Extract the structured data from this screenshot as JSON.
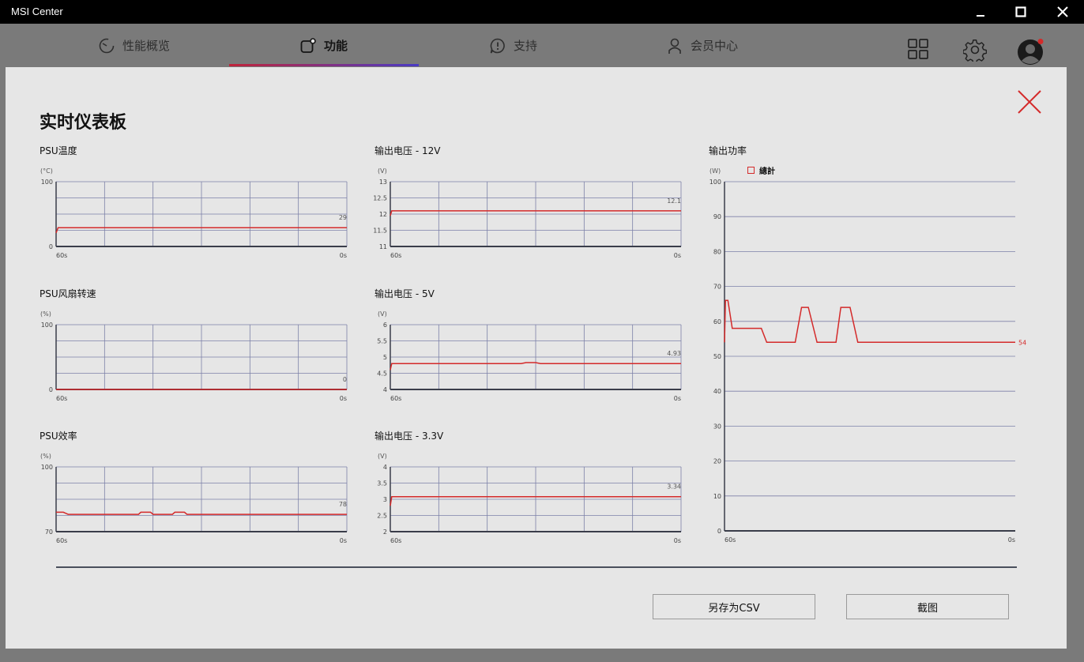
{
  "window": {
    "title": "MSI Center"
  },
  "nav": {
    "tabs": [
      {
        "label": "性能概览"
      },
      {
        "label": "功能"
      },
      {
        "label": "支持"
      },
      {
        "label": "会员中心"
      }
    ],
    "active_tab": "功能"
  },
  "dashboard": {
    "title": "实时仪表板",
    "buttons": {
      "save_csv": "另存为CSV",
      "screenshot": "截图"
    },
    "accent_color": "#d42a2a"
  },
  "chart_data": [
    {
      "id": "psu-temp",
      "type": "line",
      "title": "PSU温度",
      "unit": "(°C)",
      "ylim": [
        0,
        100
      ],
      "yticks": [
        0,
        100
      ],
      "xlabels": [
        "60s",
        "0s"
      ],
      "current_label": "29",
      "current": 29,
      "series": [
        {
          "x": [
            60,
            59.6,
            0
          ],
          "y": [
            21,
            29,
            29
          ]
        }
      ]
    },
    {
      "id": "psu-fan",
      "type": "line",
      "title": "PSU风扇转速",
      "unit": "(%)",
      "ylim": [
        0,
        100
      ],
      "yticks": [
        0,
        100
      ],
      "xlabels": [
        "60s",
        "0s"
      ],
      "current_label": "0",
      "current": 0,
      "series": [
        {
          "x": [
            60,
            0
          ],
          "y": [
            0,
            0
          ]
        }
      ]
    },
    {
      "id": "psu-eff",
      "type": "line",
      "title": "PSU效率",
      "unit": "(%)",
      "ylim": [
        70,
        100
      ],
      "yticks": [
        70,
        100
      ],
      "xlabels": [
        "60s",
        "0s"
      ],
      "current_label": "78",
      "current": 78,
      "series": [
        {
          "x": [
            60,
            58.5,
            58,
            57.5,
            43,
            42.5,
            40.5,
            40,
            36,
            35.5,
            33.5,
            33,
            0
          ],
          "y": [
            79,
            79,
            78.5,
            78,
            78,
            79,
            79,
            78,
            78,
            79,
            79,
            78,
            78
          ]
        }
      ]
    },
    {
      "id": "v12",
      "type": "line",
      "title": "输出电压 - 12V",
      "unit": "(V)",
      "ylim": [
        11,
        13
      ],
      "yticks": [
        11,
        11.5,
        12,
        12.5,
        13
      ],
      "xlabels": [
        "60s",
        "0s"
      ],
      "current_label": "12.1",
      "current": 12.1,
      "series": [
        {
          "x": [
            60,
            59.7,
            0
          ],
          "y": [
            11.95,
            12.1,
            12.1
          ]
        }
      ]
    },
    {
      "id": "v5",
      "type": "line",
      "title": "输出电压  - 5V",
      "unit": "(V)",
      "ylim": [
        4,
        6
      ],
      "yticks": [
        4,
        4.5,
        5,
        5.5,
        6
      ],
      "xlabels": [
        "60s",
        "0s"
      ],
      "current_label": "4.93",
      "current": 4.93,
      "series": [
        {
          "x": [
            60,
            59.7,
            33,
            32,
            30,
            29,
            0
          ],
          "y": [
            4.6,
            4.8,
            4.8,
            4.83,
            4.83,
            4.8,
            4.8
          ]
        }
      ]
    },
    {
      "id": "v33",
      "type": "line",
      "title": "输出电压  - 3.3V",
      "unit": "(V)",
      "ylim": [
        2,
        4
      ],
      "yticks": [
        2,
        2.5,
        3,
        3.5,
        4
      ],
      "xlabels": [
        "60s",
        "0s"
      ],
      "current_label": "3.34",
      "current": 3.34,
      "series": [
        {
          "x": [
            60,
            59.7,
            0
          ],
          "y": [
            2.8,
            3.08,
            3.08
          ]
        }
      ]
    },
    {
      "id": "power",
      "type": "line",
      "title": "输出功率",
      "unit": "(W)",
      "ylim": [
        0,
        100
      ],
      "yticks": [
        0,
        10,
        20,
        30,
        40,
        50,
        60,
        70,
        80,
        90,
        100
      ],
      "xlabels": [
        "60s",
        "0s"
      ],
      "current_label": "54",
      "current": 54,
      "legend": "總計",
      "series": [
        {
          "name": "總計",
          "x": [
            60,
            59.8,
            59.3,
            58.4,
            57.6,
            52.4,
            51.3,
            46.3,
            45.4,
            44.1,
            42.7,
            40.9,
            37.0,
            36.0,
            34.1,
            32.5,
            31.0,
            0
          ],
          "y": [
            54,
            66,
            66,
            58,
            58,
            58,
            54,
            54,
            54,
            64,
            64,
            54,
            54,
            64,
            64,
            54,
            54,
            54
          ]
        }
      ]
    }
  ]
}
